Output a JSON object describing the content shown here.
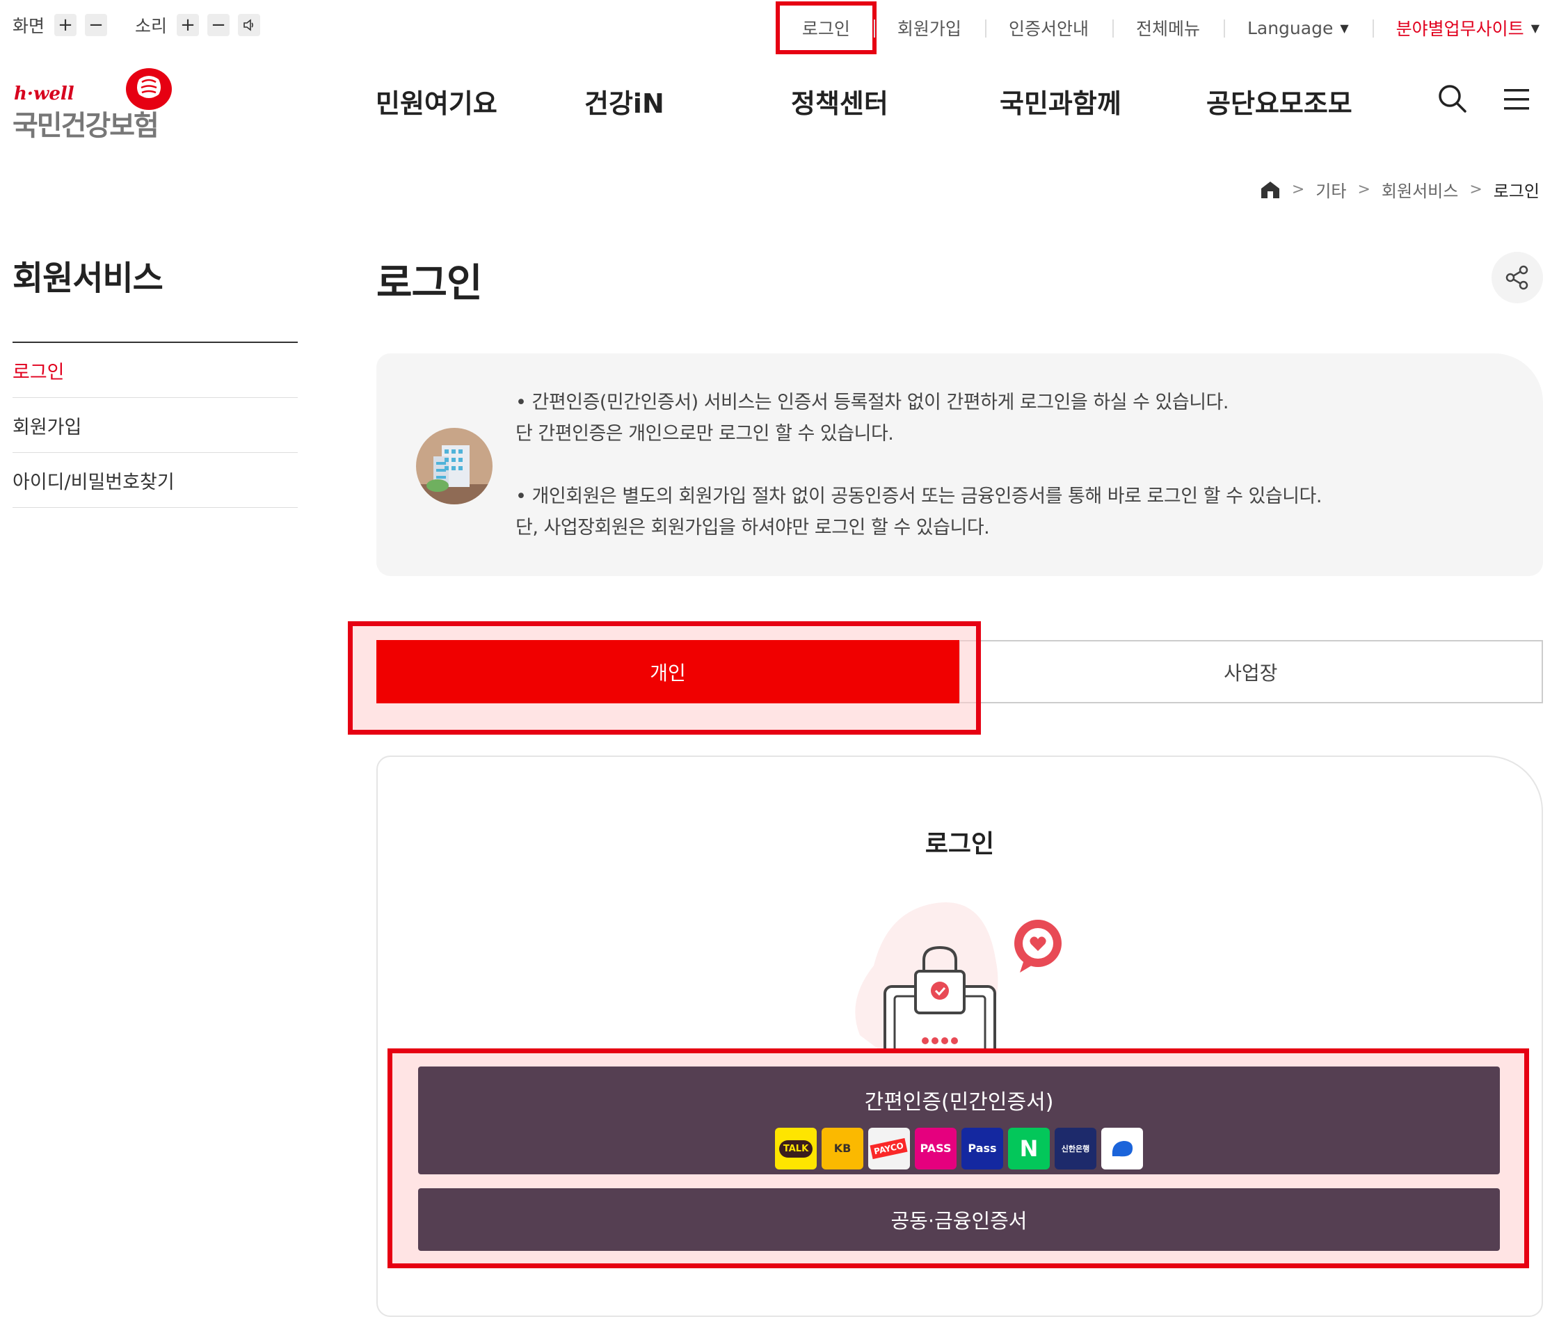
{
  "utility": {
    "screen_label": "화면",
    "sound_label": "소리",
    "plus": "+",
    "minus": "−",
    "links": [
      "로그인",
      "회원가입",
      "인증서안내",
      "전체메뉴",
      "Language",
      "분야별업무사이트"
    ]
  },
  "logo": {
    "brand": "h·well",
    "org_name": "국민건강보험"
  },
  "gnb": [
    "민원여기요",
    "건강iN",
    "정책센터",
    "국민과함께",
    "공단요모조모"
  ],
  "breadcrumb": [
    "기타",
    "회원서비스",
    "로그인"
  ],
  "side": {
    "title": "회원서비스",
    "items": [
      "로그인",
      "회원가입",
      "아이디/비밀번호찾기"
    ]
  },
  "main": {
    "title": "로그인",
    "info_lines": [
      "• 간편인증(민간인증서) 서비스는 인증서 등록절차 없이 간편하게 로그인을 하실 수 있습니다.",
      "  단 간편인증은 개인으로만 로그인 할 수 있습니다.",
      "• 개인회원은 별도의 회원가입 절차 없이 공동인증서 또는 금융인증서를 통해 바로 로그인 할 수 있습니다.",
      "  단, 사업장회원은 회원가입을 하셔야만 로그인 할 수 있습니다."
    ],
    "tabs": [
      "개인",
      "사업장"
    ],
    "card_title": "로그인",
    "simple_auth_label": "간편인증(민간인증서)",
    "providers": [
      "TALK",
      "KB",
      "PAYCO",
      "PASS",
      "Pass",
      "N",
      "신한은행",
      ""
    ],
    "cert_label": "공동·금융인증서"
  },
  "colors": {
    "brand_red": "#e1001e",
    "tab_active": "#f00000",
    "button_bg": "#553f52",
    "highlight": "#e60012"
  },
  "icons": [
    "search-icon",
    "menu-icon",
    "home-icon",
    "share-icon",
    "speaker-icon",
    "building-icon",
    "laptop-lock-icon",
    "heart-bubble-icon"
  ]
}
